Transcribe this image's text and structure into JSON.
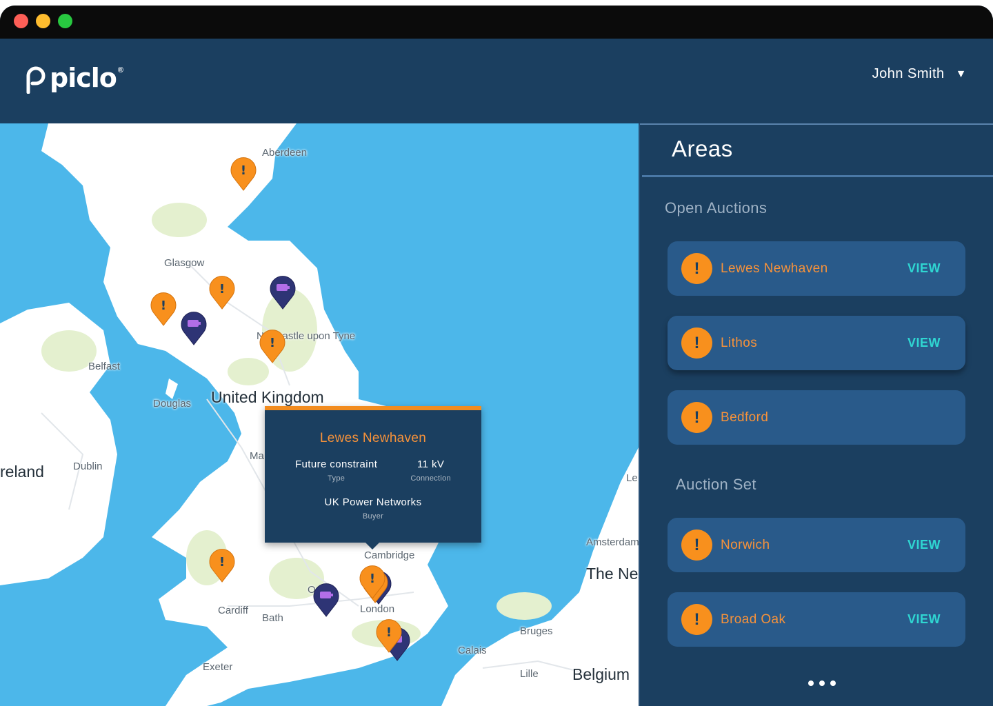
{
  "header": {
    "logo_text": "piclo",
    "logo_reg": "®",
    "user_name": "John Smith",
    "user_caret": "▼"
  },
  "map": {
    "labels": {
      "aberdeen": "Aberdeen",
      "glasgow": "Glasgow",
      "newcastle": "Newcastle upon Tyne",
      "belfast": "Belfast",
      "douglas": "Douglas",
      "united_kingdom": "United Kingdom",
      "ireland": "reland",
      "dublin": "Dublin",
      "manchester": "Ma",
      "cambridge": "Cambridge",
      "oxford": "O",
      "cardiff": "Cardiff",
      "bath": "Bath",
      "london": "London",
      "exeter": "Exeter",
      "amsterdam": "Amsterdam",
      "netherlands": "The Ne",
      "leeuwarden": "Le",
      "bruges": "Bruges",
      "calais": "Calais",
      "lille": "Lille",
      "belgium": "Belgium"
    },
    "popup": {
      "title": "Lewes Newhaven",
      "type_value": "Future constraint",
      "type_label": "Type",
      "connection_value": "11 kV",
      "connection_label": "Connection",
      "buyer_value": "UK Power Networks",
      "buyer_label": "Buyer"
    },
    "colors": {
      "sea": "#4cb7ea",
      "land": "#ffffff",
      "green": "#e4f0cf",
      "alert_pin": "#f8901d",
      "battery_pin": "#2e3475"
    }
  },
  "panel": {
    "title": "Areas",
    "sections": {
      "open_auctions": "Open Auctions",
      "auction_set": "Auction Set"
    },
    "alert_glyph": "!",
    "open_auctions": [
      {
        "name": "Lewes Newhaven",
        "action": "VIEW"
      },
      {
        "name": "Lithos",
        "action": "VIEW"
      },
      {
        "name": "Bedford",
        "action": ""
      }
    ],
    "auction_set": [
      {
        "name": "Norwich",
        "action": "VIEW"
      },
      {
        "name": "Broad Oak",
        "action": "VIEW"
      }
    ],
    "more_icon": "more-dots-icon"
  }
}
